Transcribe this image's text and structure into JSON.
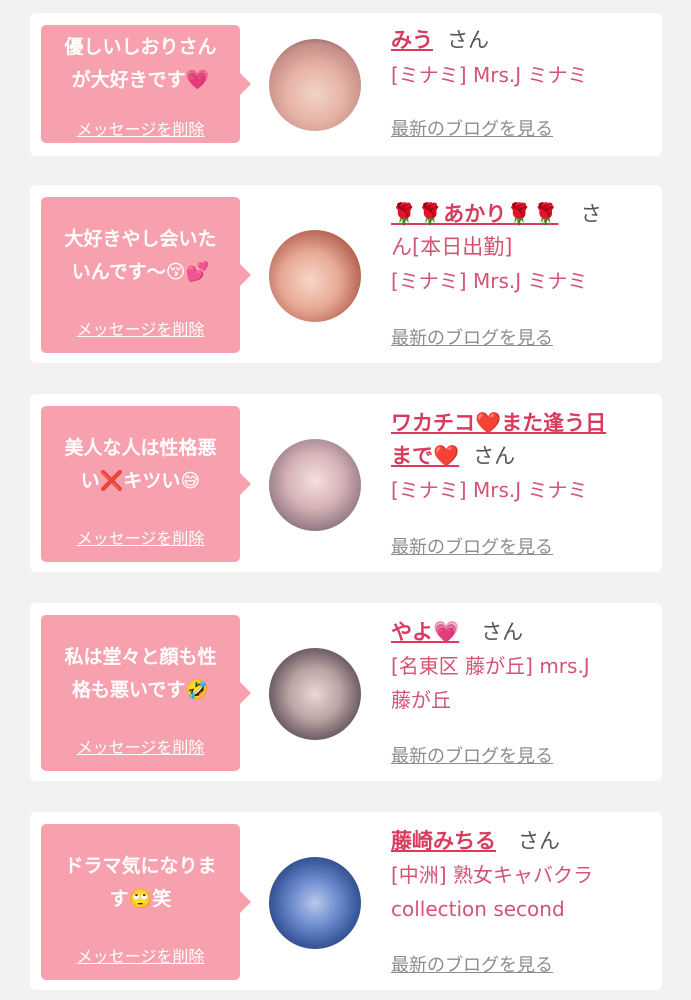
{
  "entries": [
    {
      "message_lines": [
        "優しいしおりさん",
        "が大好きです💗"
      ],
      "delete_label": "メッセージを削除",
      "name": "みう",
      "name_after": "",
      "honorific": "さん",
      "shop_lines": [
        "[ミナミ] Mrs.J ミナミ"
      ],
      "blog_label": "最新のブログを見る"
    },
    {
      "message_lines": [
        "大好きやし会いた",
        "いんです〜😚💕"
      ],
      "delete_label": "メッセージを削除",
      "name": "🌹🌹あかり🌹🌹",
      "name_after": "ん[本日出勤]",
      "honorific": "さ",
      "shop_lines": [
        "[ミナミ] Mrs.J ミナミ"
      ],
      "blog_label": "最新のブログを見る"
    },
    {
      "message_lines": [
        "美人な人は性格悪",
        "い❌キツい😅"
      ],
      "delete_label": "メッセージを削除",
      "name": "ワカチコ❤️また逢う日",
      "name_line2": "まで❤️",
      "honorific": "さん",
      "shop_lines": [
        "[ミナミ] Mrs.J ミナミ"
      ],
      "blog_label": "最新のブログを見る"
    },
    {
      "message_lines": [
        "私は堂々と顔も性",
        "格も悪いです🤣"
      ],
      "delete_label": "メッセージを削除",
      "name": "やよ💗",
      "honorific": "さん",
      "shop_lines": [
        "[名東区 藤が丘] mrs.J",
        "藤が丘"
      ],
      "blog_label": "最新のブログを見る"
    },
    {
      "message_lines": [
        "ドラマ気になりま",
        "す🙄笑"
      ],
      "delete_label": "メッセージを削除",
      "name": "藤崎みちる",
      "honorific": "さん",
      "shop_lines": [
        "[中洲] 熟女キャバクラ",
        "collection second"
      ],
      "blog_label": "最新のブログを見る"
    }
  ]
}
